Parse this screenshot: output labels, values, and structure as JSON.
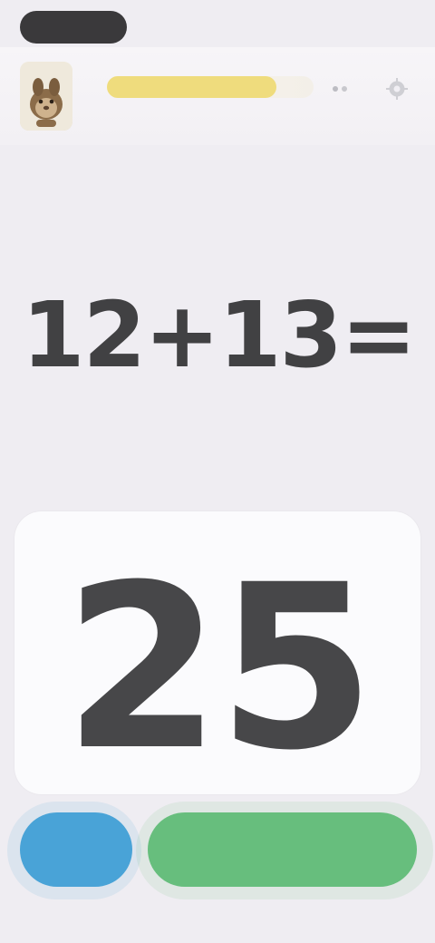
{
  "status_bar": {
    "time": ""
  },
  "header": {
    "avatar_icon": "hamster-avatar-icon",
    "progress_value": 0.82,
    "progress_color": "#efdc7d",
    "icons": [
      "small-dots-icon",
      "settings-icon"
    ]
  },
  "problem": {
    "expression": "12+13="
  },
  "answer": {
    "value": "25"
  },
  "buttons": {
    "left_label": "",
    "right_label": ""
  },
  "colors": {
    "background": "#efedf2",
    "card": "#fbfbfd",
    "left_button": "#49a3d7",
    "right_button": "#67be7d"
  }
}
